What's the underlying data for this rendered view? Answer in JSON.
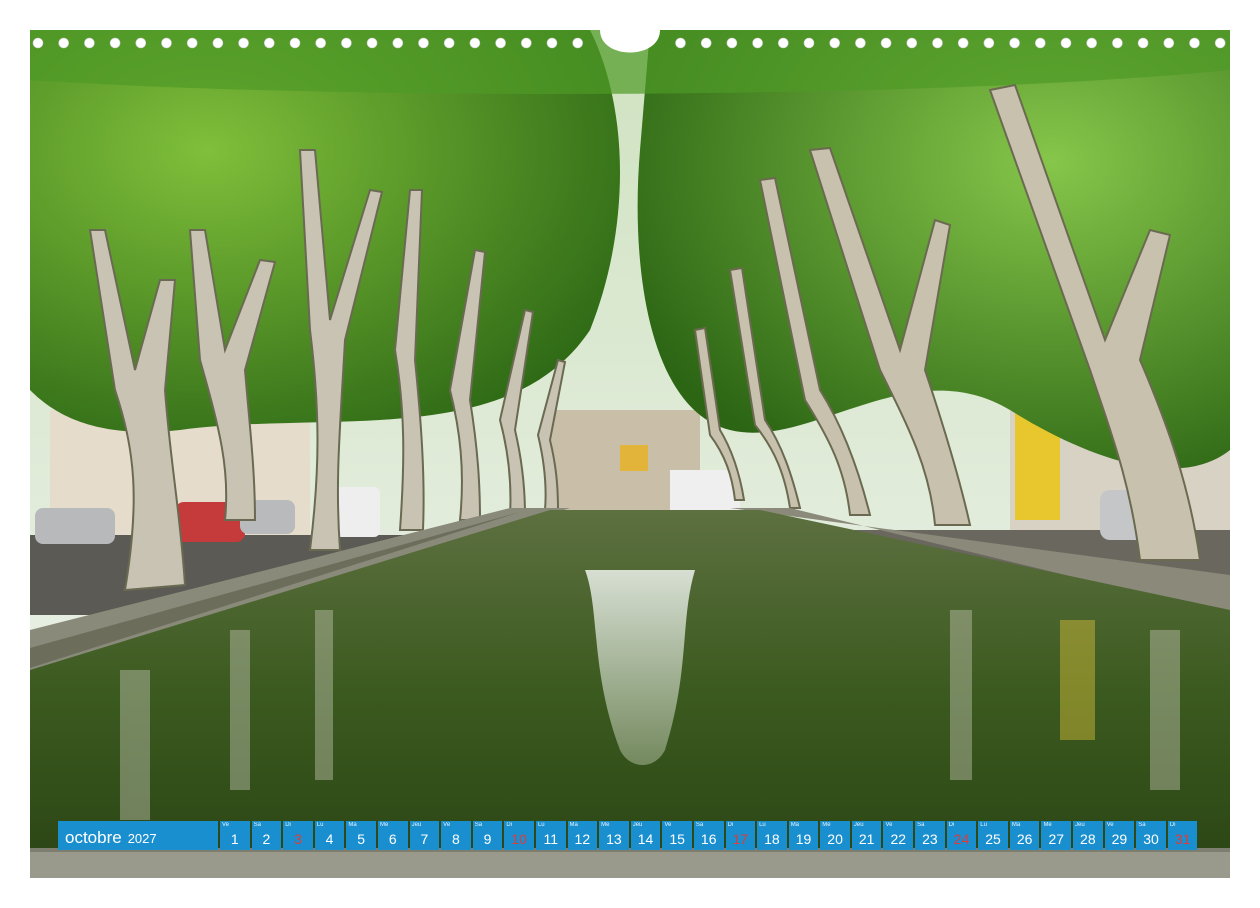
{
  "calendar": {
    "month": "octobre",
    "year": "2027",
    "days": [
      {
        "n": "1",
        "d": "Ve",
        "sun": false
      },
      {
        "n": "2",
        "d": "Sa",
        "sun": false
      },
      {
        "n": "3",
        "d": "Di",
        "sun": true
      },
      {
        "n": "4",
        "d": "Lu",
        "sun": false
      },
      {
        "n": "5",
        "d": "Ma",
        "sun": false
      },
      {
        "n": "6",
        "d": "Me",
        "sun": false
      },
      {
        "n": "7",
        "d": "Jeu",
        "sun": false
      },
      {
        "n": "8",
        "d": "Ve",
        "sun": false
      },
      {
        "n": "9",
        "d": "Sa",
        "sun": false
      },
      {
        "n": "10",
        "d": "Di",
        "sun": true
      },
      {
        "n": "11",
        "d": "Lu",
        "sun": false
      },
      {
        "n": "12",
        "d": "Ma",
        "sun": false
      },
      {
        "n": "13",
        "d": "Me",
        "sun": false
      },
      {
        "n": "14",
        "d": "Jeu",
        "sun": false
      },
      {
        "n": "15",
        "d": "Ve",
        "sun": false
      },
      {
        "n": "16",
        "d": "Sa",
        "sun": false
      },
      {
        "n": "17",
        "d": "Di",
        "sun": true
      },
      {
        "n": "18",
        "d": "Lu",
        "sun": false
      },
      {
        "n": "19",
        "d": "Ma",
        "sun": false
      },
      {
        "n": "20",
        "d": "Me",
        "sun": false
      },
      {
        "n": "21",
        "d": "Jeu",
        "sun": false
      },
      {
        "n": "22",
        "d": "Ve",
        "sun": false
      },
      {
        "n": "23",
        "d": "Sa",
        "sun": false
      },
      {
        "n": "24",
        "d": "Di",
        "sun": true
      },
      {
        "n": "25",
        "d": "Lu",
        "sun": false
      },
      {
        "n": "26",
        "d": "Ma",
        "sun": false
      },
      {
        "n": "27",
        "d": "Me",
        "sun": false
      },
      {
        "n": "28",
        "d": "Jeu",
        "sun": false
      },
      {
        "n": "29",
        "d": "Ve",
        "sun": false
      },
      {
        "n": "30",
        "d": "Sa",
        "sun": false
      },
      {
        "n": "31",
        "d": "Di",
        "sun": true
      }
    ]
  },
  "colors": {
    "bar": "#1a8fd0",
    "sunday_number": "#e03a3a",
    "foliage": "#3f8a1f",
    "water": "#3a5a20",
    "sky": "#e8eef0"
  }
}
